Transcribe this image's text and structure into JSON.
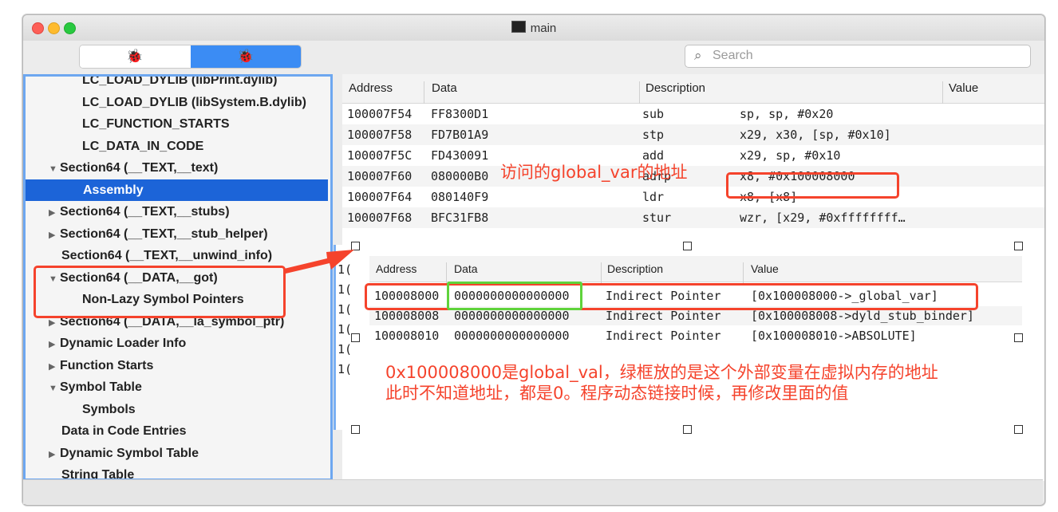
{
  "window": {
    "title": "main",
    "tl_icons": [
      "close-icon",
      "minimize-icon",
      "zoom-icon"
    ]
  },
  "toolbar": {
    "left_icon": "🐞",
    "right_icon": "🐞",
    "search_placeholder": "Search",
    "search_icon": "🔍"
  },
  "sidebar": {
    "items": [
      {
        "label": "LC_LOAD_DYLIB (libPrint.dylib)",
        "triangle": ""
      },
      {
        "label": "LC_LOAD_DYLIB (libSystem.B.dylib)",
        "triangle": ""
      },
      {
        "label": "LC_FUNCTION_STARTS",
        "triangle": ""
      },
      {
        "label": "LC_DATA_IN_CODE",
        "triangle": ""
      },
      {
        "label": "Section64 (__TEXT,__text)",
        "triangle": "▼"
      },
      {
        "label": "Assembly",
        "triangle": ""
      },
      {
        "label": "Section64 (__TEXT,__stubs)",
        "triangle": "▶"
      },
      {
        "label": "Section64 (__TEXT,__stub_helper)",
        "triangle": "▶"
      },
      {
        "label": "Section64 (__TEXT,__unwind_info)",
        "triangle": ""
      },
      {
        "label": "Section64 (__DATA,__got)",
        "triangle": "▼"
      },
      {
        "label": "Non-Lazy Symbol Pointers",
        "triangle": ""
      },
      {
        "label": "Section64 (__DATA,__la_symbol_ptr)",
        "triangle": "▶"
      },
      {
        "label": "Dynamic Loader Info",
        "triangle": "▶"
      },
      {
        "label": "Function Starts",
        "triangle": "▶"
      },
      {
        "label": "Symbol Table",
        "triangle": "▼"
      },
      {
        "label": "Symbols",
        "triangle": ""
      },
      {
        "label": "Data in Code Entries",
        "triangle": ""
      },
      {
        "label": "Dynamic Symbol Table",
        "triangle": "▶"
      },
      {
        "label": "String Table",
        "triangle": ""
      }
    ]
  },
  "table": {
    "headers": {
      "address": "Address",
      "data": "Data",
      "description": "Description",
      "value": "Value"
    },
    "rows": [
      {
        "address": "100007F54",
        "data": "FF8300D1",
        "desc": "sub",
        "value": "sp, sp, #0x20"
      },
      {
        "address": "100007F58",
        "data": "FD7B01A9",
        "desc": "stp",
        "value": "x29, x30, [sp, #0x10]"
      },
      {
        "address": "100007F5C",
        "data": "FD430091",
        "desc": "add",
        "value": "x29, sp, #0x10"
      },
      {
        "address": "100007F60",
        "data": "080000B0",
        "desc": "adrp",
        "value": "x8, #0x100008000"
      },
      {
        "address": "100007F64",
        "data": "080140F9",
        "desc": "ldr",
        "value": "x8, [x8]"
      },
      {
        "address": "100007F68",
        "data": "BFC31FB8",
        "desc": "stur",
        "value": "wzr, [x29, #0xffffffff…"
      }
    ]
  },
  "got_table": {
    "headers": {
      "address": "Address",
      "data": "Data",
      "description": "Description",
      "value": "Value"
    },
    "rows": [
      {
        "address": "100008000",
        "data": "0000000000000000",
        "desc": "Indirect Pointer",
        "value": "[0x100008000->_global_var]"
      },
      {
        "address": "100008008",
        "data": "0000000000000000",
        "desc": "Indirect Pointer",
        "value": "[0x100008008->dyld_stub_binder]"
      },
      {
        "address": "100008010",
        "data": "0000000000000000",
        "desc": "Indirect Pointer",
        "value": "[0x100008010->ABSOLUTE]"
      }
    ],
    "strip_chars": [
      "1(",
      "1(",
      "1(",
      "1(",
      "1(",
      "1("
    ]
  },
  "annotations": {
    "top_note": "访问的global_var的地址",
    "bottom_line1": "0x100008000是global_val，绿框放的是这个外部变量在虚拟内存的地址",
    "bottom_line2": "此时不知道地址，都是0。程序动态链接时候，再修改里面的值",
    "color": "#f5432c",
    "green": "#5fd33b"
  }
}
